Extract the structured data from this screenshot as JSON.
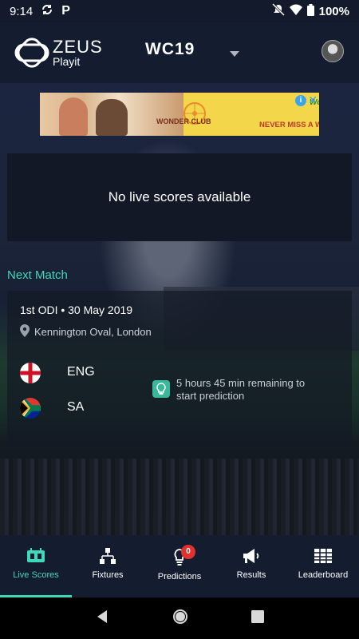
{
  "status_bar": {
    "time": "9:14",
    "battery": "100%"
  },
  "header": {
    "brand": "ZEUS",
    "brand_sub": "Playit",
    "tournament": "WC19"
  },
  "ad": {
    "brand_logo": "WONDER CLUB",
    "brand_small": "Wondera",
    "tagline": "NEVER MISS A WONDER",
    "info": "i",
    "close": "✕"
  },
  "live_scores": {
    "empty_message": "No live scores available"
  },
  "next_match": {
    "title": "Next Match",
    "info": "1st ODI • 30 May 2019",
    "venue": "Kennington Oval, London",
    "team1": "ENG",
    "team2": "SA",
    "prediction_text": "5 hours 45 min remaining to start prediction"
  },
  "nav": {
    "items": [
      {
        "label": "Live Scores",
        "icon": "scoreboard-icon",
        "active": true
      },
      {
        "label": "Fixtures",
        "icon": "bracket-icon"
      },
      {
        "label": "Predictions",
        "icon": "bulb-icon",
        "badge": "0"
      },
      {
        "label": "Results",
        "icon": "megaphone-icon"
      },
      {
        "label": "Leaderboard",
        "icon": "table-icon"
      }
    ]
  },
  "colors": {
    "accent": "#3fd8b8",
    "header_bg": "#141c30",
    "badge": "#e0312f"
  }
}
